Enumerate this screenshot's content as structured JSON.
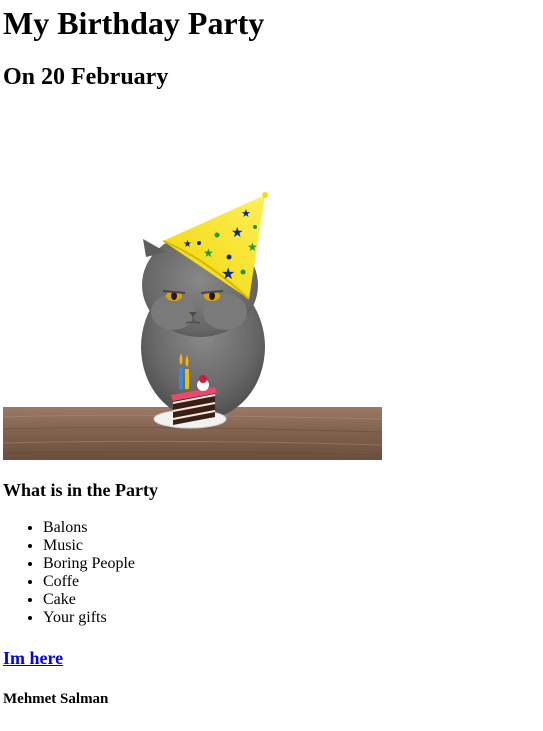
{
  "page": {
    "title": "My Birthday Party",
    "subtitle": "On 20 February",
    "section_title": "What is in the Party",
    "items": [
      "Balons",
      "Music",
      "Boring People",
      "Coffe",
      "Cake",
      "Your gifts"
    ],
    "link_text": "Im here",
    "author": "Mehmet Salman"
  },
  "image": {
    "subject": "grey-cat-party-hat-cake-illustration",
    "colors": {
      "hat": "#f4dc1c",
      "table": "#8b6a55",
      "cat": "#6d6d6d",
      "cake": "#3b1f14",
      "plate": "#f2f2f2",
      "link": "#0000ee"
    }
  }
}
